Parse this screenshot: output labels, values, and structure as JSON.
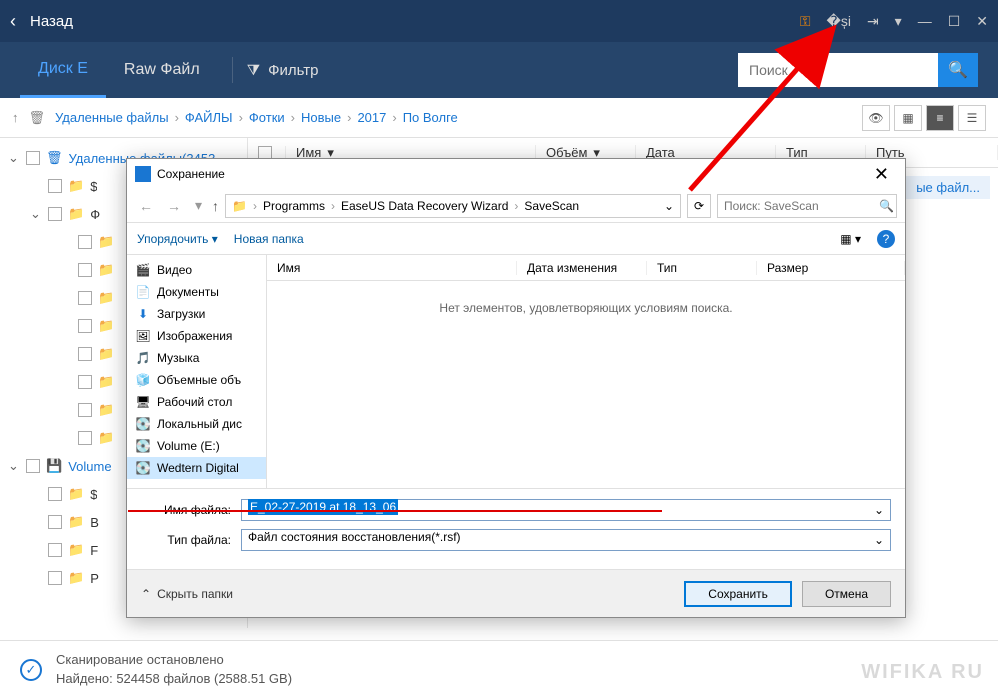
{
  "titlebar": {
    "back": "Назад"
  },
  "toolbar": {
    "tab_disk": "Диск E",
    "tab_raw": "Raw Файл",
    "filter": "Фильтр",
    "search_placeholder": "Поиск"
  },
  "breadcrumb": {
    "items": [
      "Удаленные файлы",
      "ФАЙЛЫ",
      "Фотки",
      "Новые",
      "2017",
      "По Волге"
    ]
  },
  "columns": {
    "name": "Имя",
    "size": "Объём",
    "date": "Дата",
    "type": "Тип",
    "path": "Путь"
  },
  "tree": {
    "deleted": "Удаленные  файлы(3453",
    "volume": "Volume",
    "generic_folder_prefix": "$"
  },
  "content_row": {
    "truncated": "ые файл..."
  },
  "dialog": {
    "title": "Сохранение",
    "path": [
      "Programms",
      "EaseUS Data Recovery Wizard",
      "SaveScan"
    ],
    "search_placeholder": "Поиск: SaveScan",
    "organize": "Упорядочить",
    "new_folder": "Новая папка",
    "cols": {
      "name": "Имя",
      "modified": "Дата изменения",
      "type": "Тип",
      "size": "Размер"
    },
    "empty": "Нет элементов, удовлетворяющих условиям поиска.",
    "sidebar": [
      "Видео",
      "Документы",
      "Загрузки",
      "Изображения",
      "Музыка",
      "Объемные объ",
      "Рабочий стол",
      "Локальный дис",
      "Volume (E:)",
      "Wedtern Digital"
    ],
    "filename_label": "Имя файла:",
    "filename_value": "E_02-27-2019 at 18_13_06",
    "filetype_label": "Тип файла:",
    "filetype_value": "Файл состояния восстановления(*.rsf)",
    "hide_folders": "Скрыть папки",
    "save": "Сохранить",
    "cancel": "Отмена"
  },
  "footer": {
    "line1": "Сканирование остановлено",
    "line2": "Найдено: 524458 файлов (2588.51 GB)"
  },
  "watermark": "WIFIKA RU"
}
